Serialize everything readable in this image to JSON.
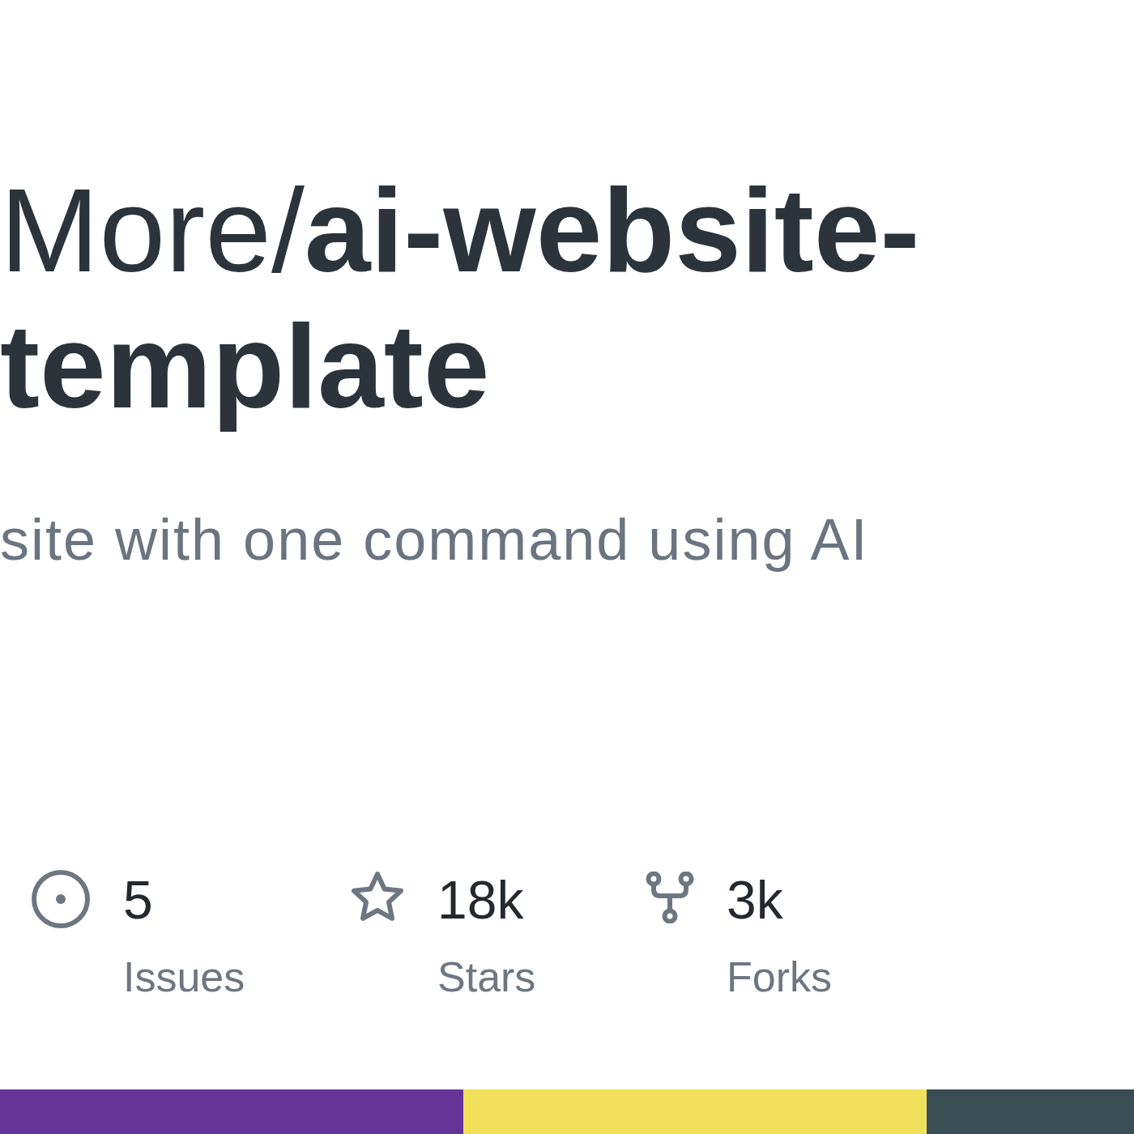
{
  "title": "More/**ai-website-template**",
  "description": "site with one command using AI",
  "stats": [
    {
      "kind": "issues",
      "value": "5",
      "label": "Issues"
    },
    {
      "kind": "stars",
      "value": "18k",
      "label": "Stars"
    },
    {
      "kind": "forks",
      "value": "3k",
      "label": "Forks"
    }
  ],
  "language_bar": [
    {
      "color": "#663399"
    },
    {
      "color": "#f1e05a"
    },
    {
      "color": "#384d54"
    }
  ]
}
